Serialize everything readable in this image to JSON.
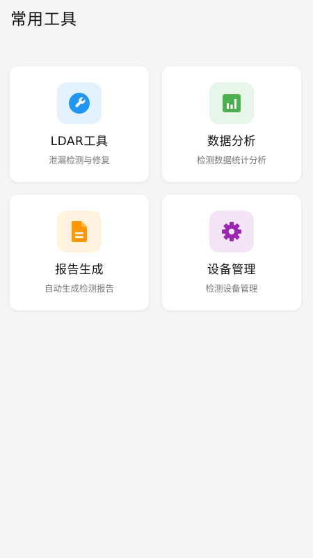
{
  "header": {
    "title": "常用工具"
  },
  "cards": [
    {
      "title": "LDAR工具",
      "subtitle": "泄漏检测与修复",
      "icon": "wrench-icon",
      "accent": "#2196F3",
      "bg": "#E3F2FD"
    },
    {
      "title": "数据分析",
      "subtitle": "检测数据统计分析",
      "icon": "bar-chart-icon",
      "accent": "#4CAF50",
      "bg": "#E8F5E9"
    },
    {
      "title": "报告生成",
      "subtitle": "自动生成检测报告",
      "icon": "document-icon",
      "accent": "#FF9800",
      "bg": "#FFF3E0"
    },
    {
      "title": "设备管理",
      "subtitle": "检测设备管理",
      "icon": "gear-icon",
      "accent": "#9C27B0",
      "bg": "#F3E5F5"
    }
  ]
}
